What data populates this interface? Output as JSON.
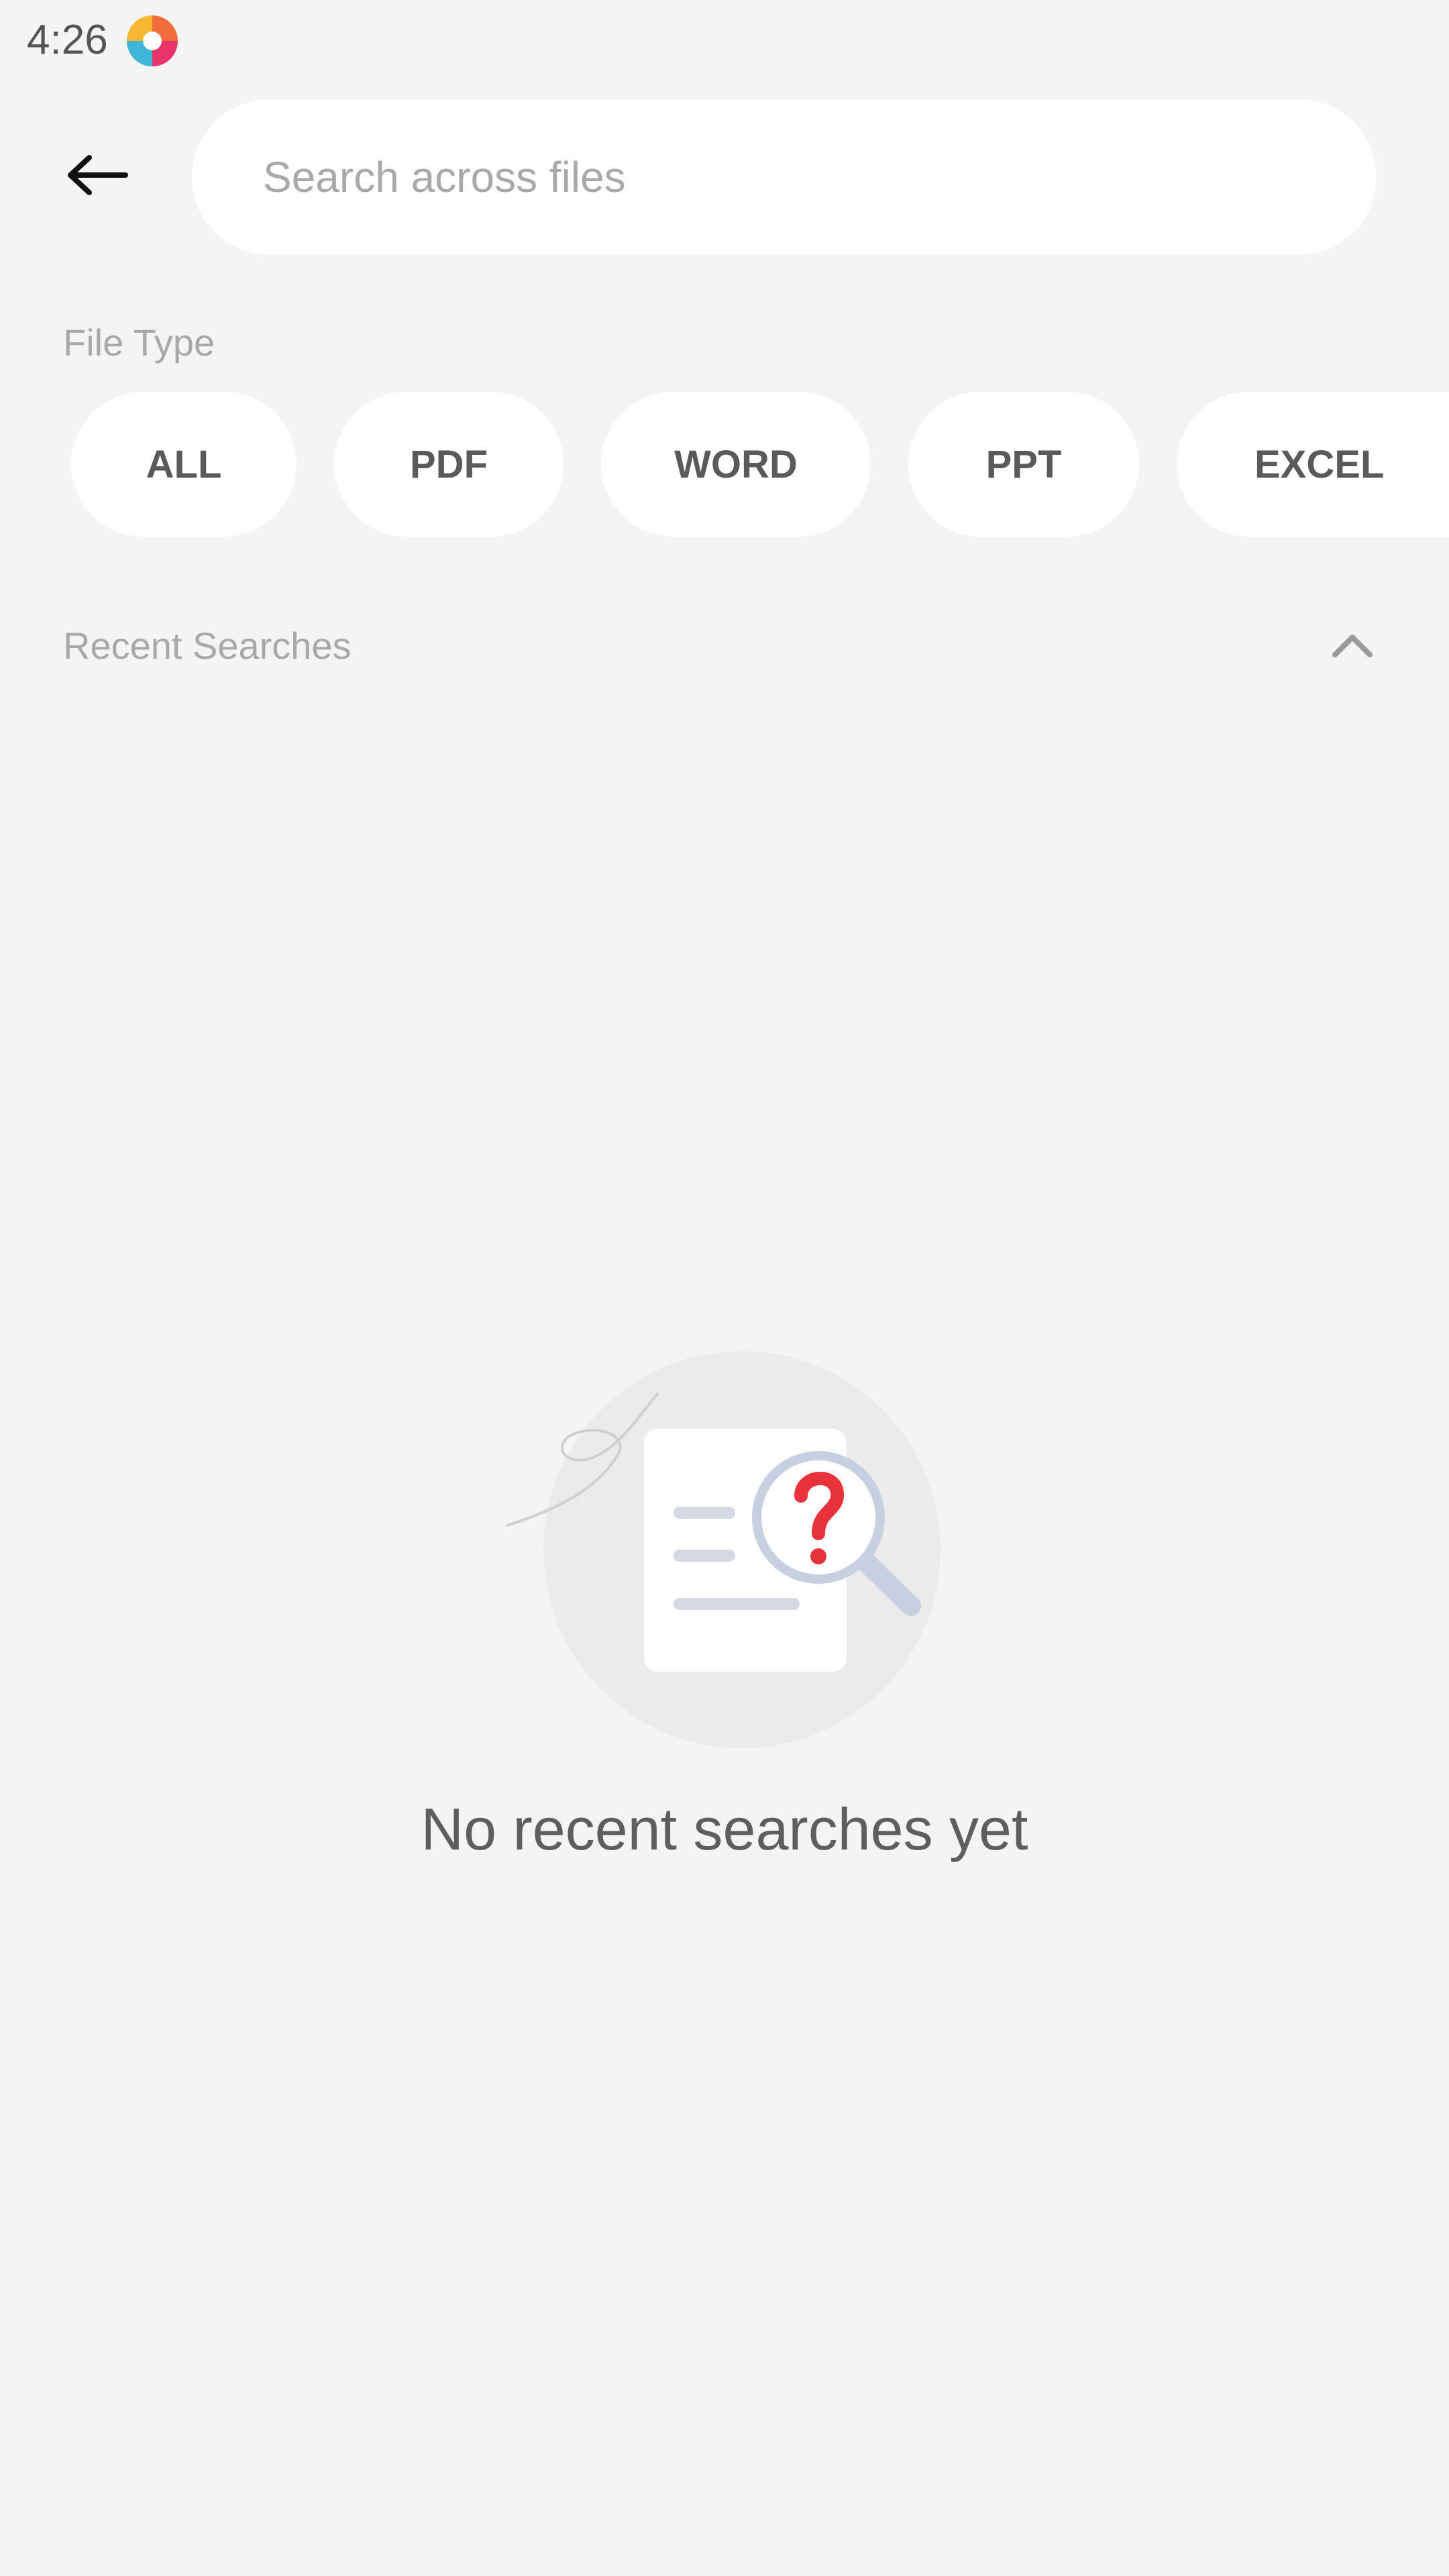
{
  "status_bar": {
    "time": "4:26",
    "app_icon": "app-logo-icon"
  },
  "header": {
    "back_icon": "back-arrow-icon",
    "search": {
      "value": "",
      "placeholder": "Search across files"
    }
  },
  "file_type": {
    "label": "File Type",
    "chips": [
      {
        "label": "ALL"
      },
      {
        "label": "PDF"
      },
      {
        "label": "WORD"
      },
      {
        "label": "PPT"
      },
      {
        "label": "EXCEL"
      }
    ]
  },
  "recent_searches": {
    "label": "Recent Searches",
    "toggle_icon": "chevron-up-icon",
    "empty_illustration": "document-search-icon",
    "empty_message": "No recent searches yet"
  },
  "colors": {
    "background": "#f4f4f4",
    "surface": "#ffffff",
    "label_text": "#a8a8a8",
    "chip_text": "#5a5a5a",
    "question_mark": "#e8333c",
    "illustration_accent": "#c7d0e0"
  }
}
